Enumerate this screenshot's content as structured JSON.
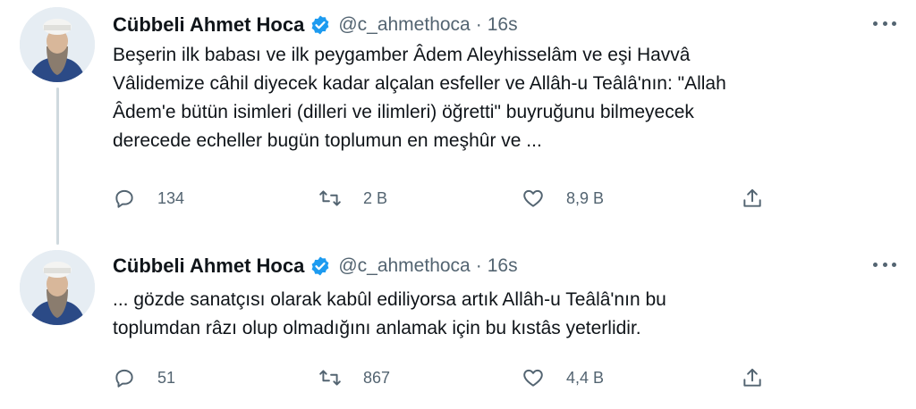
{
  "tweets": [
    {
      "author_name": "Cübbeli Ahmet Hoca",
      "handle": "@c_ahmethoca",
      "separator": "·",
      "time": "16s",
      "lines": [
        "Beşerin ilk babası ve ilk peygamber Âdem Aleyhisselâm ve eşi Havvâ",
        "Vâlidemize câhil diyecek kadar alçalan esfeller ve Allâh-u Teâlâ'nın: \"Allah",
        "Âdem'e bütün isimleri (dilleri ve ilimleri) öğretti\" buyruğunu bilmeyecek",
        "derecede echeller bugün toplumun en meşhûr ve ..."
      ],
      "replies": "134",
      "retweets": "2 B",
      "likes": "8,9 B"
    },
    {
      "author_name": "Cübbeli Ahmet Hoca",
      "handle": "@c_ahmethoca",
      "separator": "·",
      "time": "16s",
      "lines": [
        "... gözde sanatçısı olarak kabûl ediliyorsa artık Allâh-u Teâlâ'nın bu",
        "toplumdan râzı olup olmadığını anlamak için bu kıstâs yeterlidir."
      ],
      "replies": "51",
      "retweets": "867",
      "likes": "4,4 B"
    }
  ],
  "icons": {
    "verified": "verified-badge-icon",
    "more": "more-horizontal-icon",
    "reply": "reply-icon",
    "retweet": "retweet-icon",
    "like": "heart-icon",
    "share": "share-icon"
  },
  "colors": {
    "verified": "#1d9bf0",
    "secondary_text": "#536471",
    "primary_text": "#0f1419",
    "thread_line": "#cfd9de"
  }
}
